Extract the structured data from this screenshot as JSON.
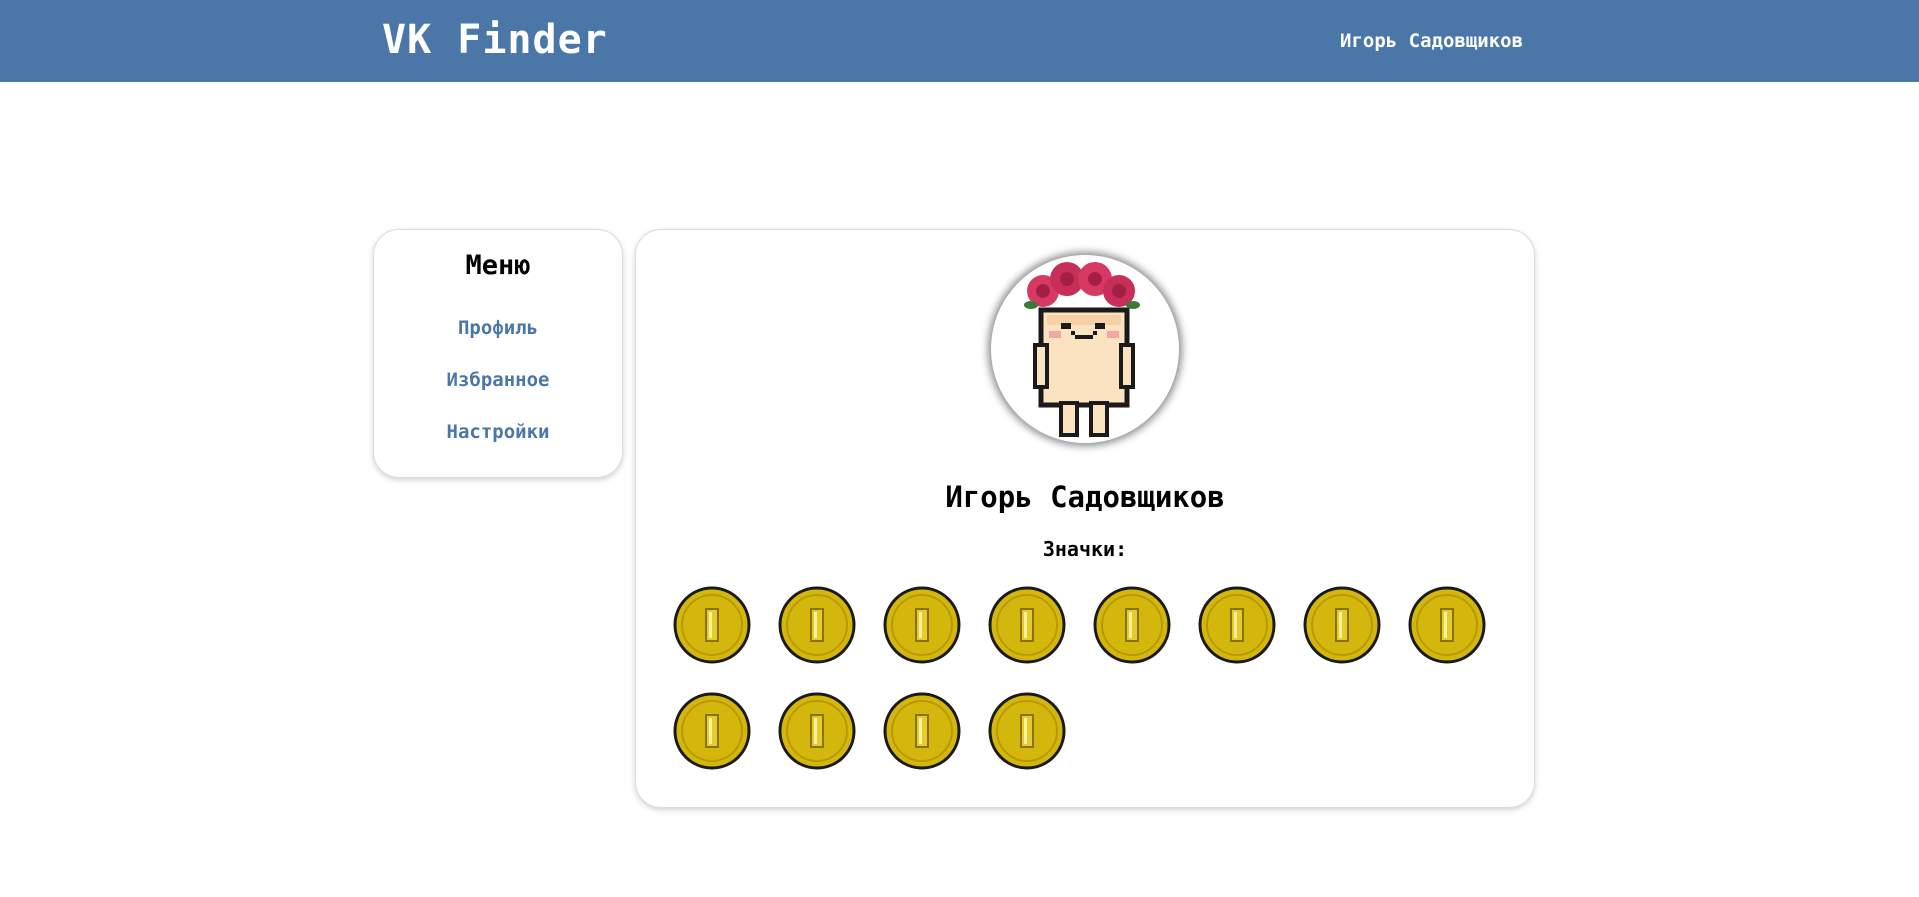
{
  "header": {
    "logo": "VK Finder",
    "user_name": "Игорь Садовщиков"
  },
  "menu": {
    "title": "Меню",
    "items": [
      {
        "label": "Профиль"
      },
      {
        "label": "Избранное"
      },
      {
        "label": "Настройки"
      }
    ]
  },
  "profile": {
    "name": "Игорь Садовщиков",
    "badges_label": "Значки:",
    "badges": [
      {
        "icon": "gold-coin-icon"
      },
      {
        "icon": "gold-coin-icon"
      },
      {
        "icon": "gold-coin-icon"
      },
      {
        "icon": "gold-coin-icon"
      },
      {
        "icon": "gold-coin-icon"
      },
      {
        "icon": "gold-coin-icon"
      },
      {
        "icon": "gold-coin-icon"
      },
      {
        "icon": "gold-coin-icon"
      },
      {
        "icon": "gold-coin-icon"
      },
      {
        "icon": "gold-coin-icon"
      },
      {
        "icon": "gold-coin-icon"
      },
      {
        "icon": "gold-coin-icon"
      }
    ]
  },
  "colors": {
    "header_bg": "#4a76a8",
    "link": "#4a76a8",
    "coin": "#d4b70c"
  }
}
